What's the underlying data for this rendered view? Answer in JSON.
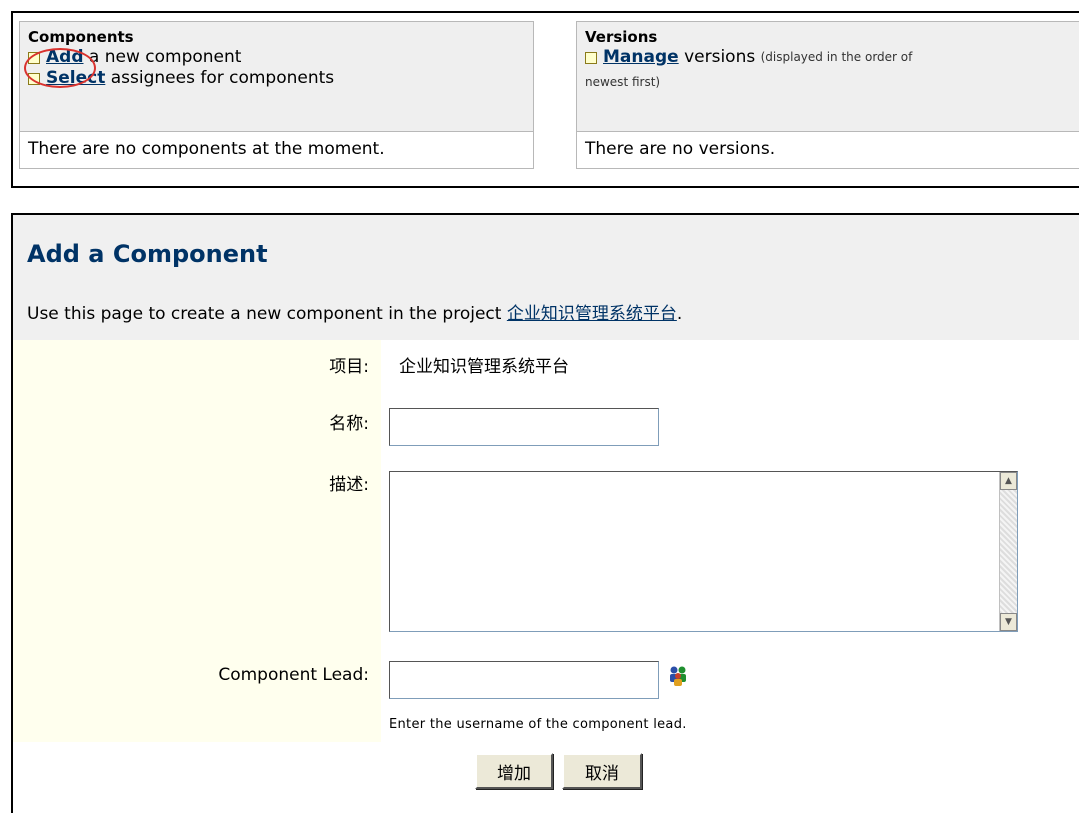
{
  "components_panel": {
    "title": "Components",
    "add_link": "Add",
    "add_text": " a new component",
    "select_link": "Select",
    "select_text": " assignees for components",
    "empty_text": "There are no components at the moment."
  },
  "versions_panel": {
    "title": "Versions",
    "manage_link": "Manage",
    "manage_text": " versions ",
    "manage_note_1": "(displayed in the order of",
    "manage_note_2": "newest first)",
    "empty_text": "There are no versions."
  },
  "form": {
    "title": "Add a Component",
    "description_prefix": "Use this page to create a new component in the project ",
    "project_link": "企业知识管理系统平台",
    "description_suffix": ".",
    "project_label": "项目:",
    "project_value": "企业知识管理系统平台",
    "name_label": "名称:",
    "name_value": "",
    "desc_label": "描述:",
    "desc_value": "",
    "lead_label": "Component Lead:",
    "lead_value": "",
    "lead_hint": "Enter the username of the component lead.",
    "add_button": "增加",
    "cancel_button": "取消"
  },
  "icons": {
    "checkbox_bullet": "square-bullet-icon",
    "user_picker": "user-picker-icon"
  },
  "colors": {
    "link": "#003366",
    "highlight_circle": "#d9332f",
    "label_bg": "#ffffee"
  }
}
